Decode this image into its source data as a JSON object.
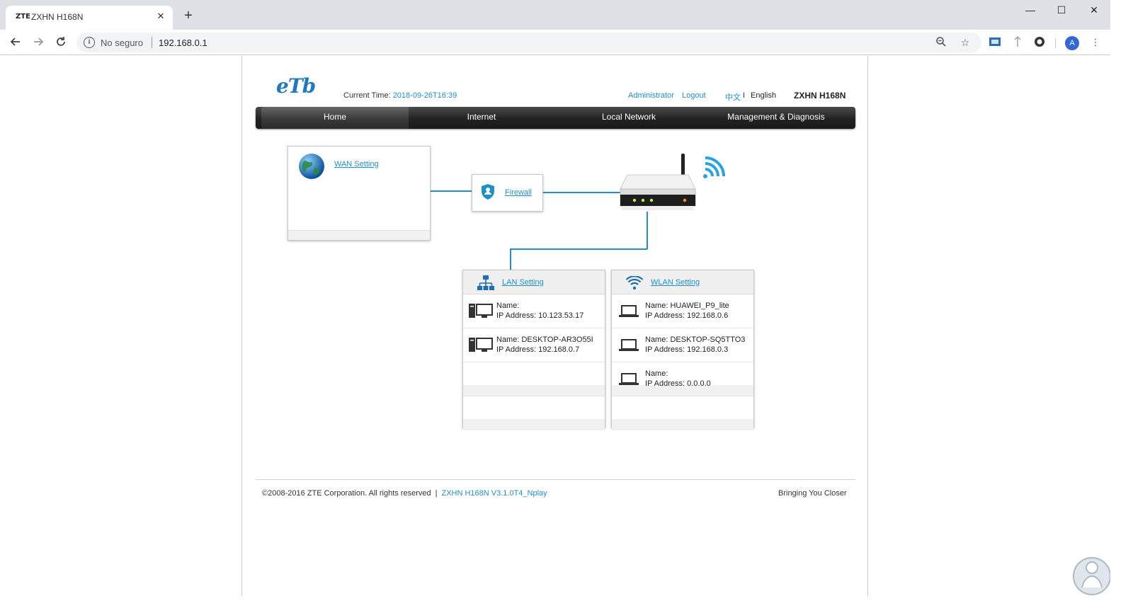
{
  "browser": {
    "tab_favicon_text": "ZTE",
    "tab_title": "ZXHN H168N",
    "tab_close": "✕",
    "new_tab": "+",
    "security_label": "No seguro",
    "url": "192.168.0.1",
    "window_controls": {
      "minimize": "—",
      "maximize": "☐",
      "close": "✕"
    },
    "avatar_letter": "A"
  },
  "header": {
    "logo": "eTb",
    "current_time_label": "Current Time: ",
    "current_time_value": "2018-09-26T16:39",
    "administrator": "Administrator",
    "logout": "Logout",
    "lang_cn": "中文",
    "lang_sep": "I",
    "lang_en": "English",
    "model": "ZXHN H168N"
  },
  "menu": {
    "items": [
      {
        "label": "Home",
        "active": true
      },
      {
        "label": "Internet"
      },
      {
        "label": "Local Network"
      },
      {
        "label": "Management & Diagnosis"
      }
    ]
  },
  "topology": {
    "wan_label": "WAN Setting",
    "firewall_label": "Firewall",
    "lan": {
      "title": "LAN Setting",
      "devices": [
        {
          "name": "Name:",
          "ip": "IP Address: 10.123.53.17"
        },
        {
          "name": "Name: DESKTOP-AR3O55I",
          "ip": "IP Address: 192.168.0.7"
        }
      ]
    },
    "wlan": {
      "title": "WLAN Setting",
      "devices": [
        {
          "name": "Name: HUAWEI_P9_lite",
          "ip": "IP Address: 192.168.0.6"
        },
        {
          "name": "Name: DESKTOP-SQ5TTO3",
          "ip": "IP Address: 192.168.0.3"
        },
        {
          "name": "Name:",
          "ip": "IP Address: 0.0.0.0"
        }
      ]
    }
  },
  "footer": {
    "copyright": "©2008-2016 ZTE Corporation. All rights reserved",
    "separator": "|",
    "version": "ZXHN H168N V3.1.0T4_Nplay",
    "slogan": "Bringing You Closer"
  },
  "colors": {
    "accent": "#1f8fc7",
    "menubar": "#222222",
    "brand": "#1f78c1"
  }
}
